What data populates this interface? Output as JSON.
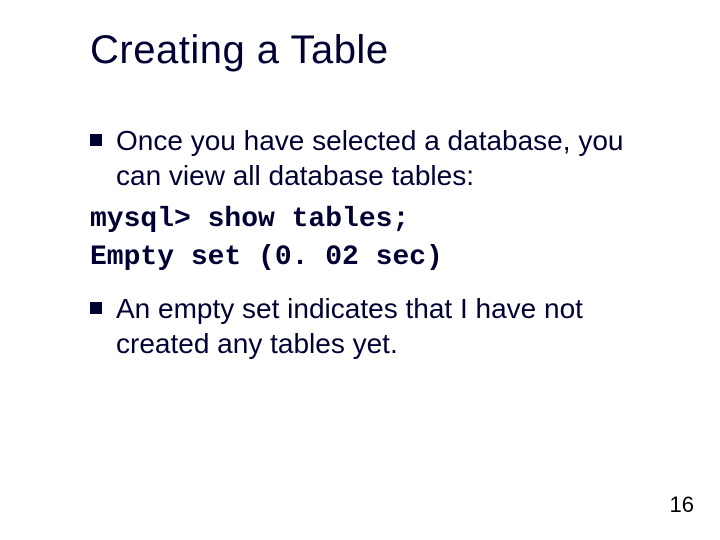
{
  "title": "Creating a Table",
  "bullets": [
    "Once you have selected a database, you can view all database tables:",
    "An empty set indicates that I have not created any tables yet."
  ],
  "code": [
    "mysql> show tables;",
    "Empty set (0. 02 sec)"
  ],
  "page_number": "16"
}
